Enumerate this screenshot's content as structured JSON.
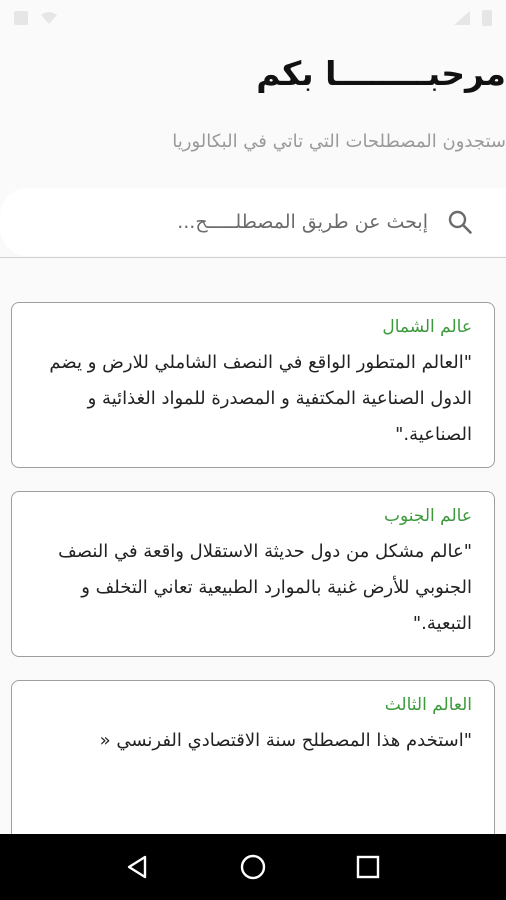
{
  "header": {
    "greeting": "مرحبــــــــا بكم",
    "subtitle": "ستجدون المصطلحات التي تاتي في البكالوريا"
  },
  "search": {
    "placeholder": "إبحث عن طريق المصطلـــــح..."
  },
  "terms": [
    {
      "title": "عالم الشمال",
      "definition": "\"العالم المتطور الواقع في النصف الشاملي للارض و يضم الدول الصناعية المكتفية و المصدرة للمواد الغذائية و الصناعية.\""
    },
    {
      "title": "عالم الجنوب",
      "definition": "\"عالم مشكل من دول حديثة الاستقلال واقعة في النصف الجنوبي للأرض غنية بالموارد الطبيعية تعاني التخلف و التبعية.\""
    },
    {
      "title": "العالم الثالث",
      "definition": "\"استخدم هذا المصطلح سنة الاقتصادي الفرنسي «"
    }
  ],
  "colors": {
    "accent_green": "#3c9a3c",
    "nav_bar": "#000000"
  },
  "icons": {
    "search": "search-icon",
    "back": "back-triangle-icon",
    "home": "home-circle-icon",
    "recents": "recents-square-icon"
  }
}
